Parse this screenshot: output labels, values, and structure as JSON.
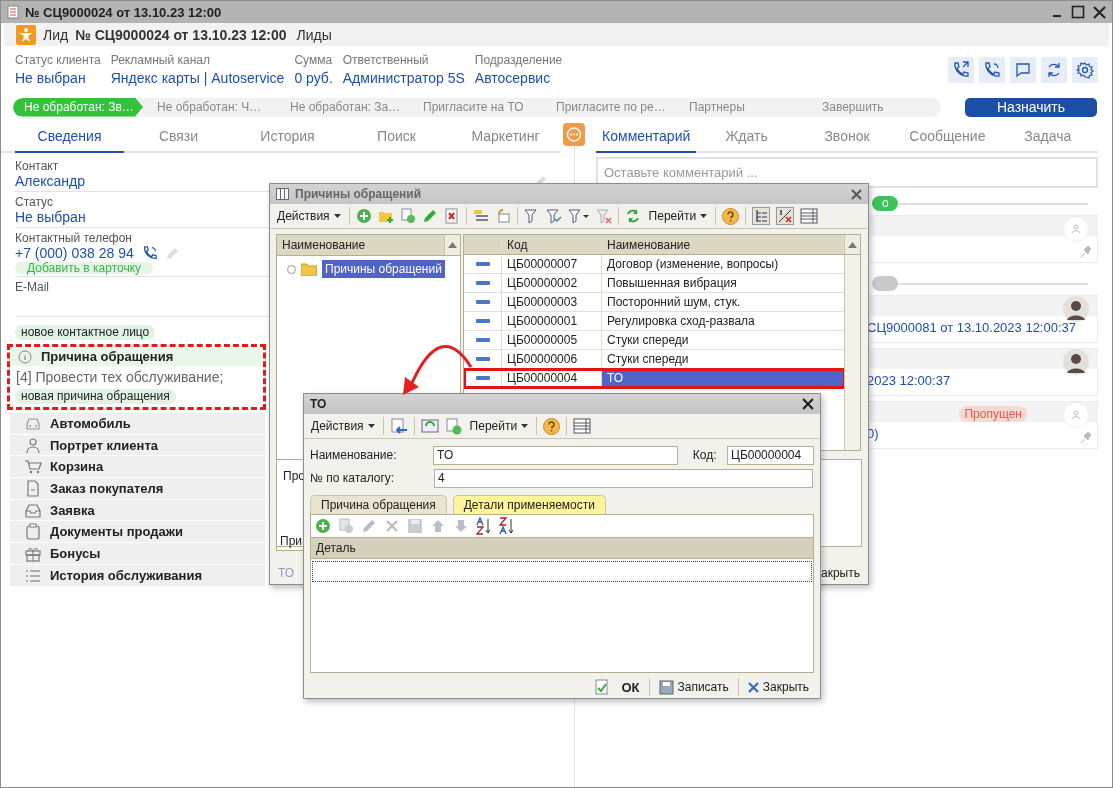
{
  "window": {
    "title": "№ СЦ9000024 от 13.10.23 12:00"
  },
  "header": {
    "type_label": "Лид",
    "number": "№ СЦ9000024 от 13.10.23 12:00",
    "section": "Лиды"
  },
  "fields": [
    {
      "label": "Статус клиента",
      "value": "Не выбран"
    },
    {
      "label": "Рекламный канал",
      "value": "Яндекс карты | Autoservice"
    },
    {
      "label": "Сумма",
      "value": "0 руб."
    },
    {
      "label": "Ответственный",
      "value": "Администратор 5S"
    },
    {
      "label": "Подразделение",
      "value": "Автосервис"
    }
  ],
  "stages": [
    {
      "label": "Не обработан: Зв…",
      "selected": true
    },
    {
      "label": "Не обработан: Ч…",
      "selected": false
    },
    {
      "label": "Не обработан: За…",
      "selected": false
    },
    {
      "label": "Пригласите на ТО",
      "selected": false
    },
    {
      "label": "Пригласите по ре…",
      "selected": false
    },
    {
      "label": "Партнеры",
      "selected": false
    },
    {
      "label": "Завершить",
      "selected": false
    }
  ],
  "assign_button": "Назначить",
  "left_tabs": [
    {
      "label": "Сведения",
      "selected": true
    },
    {
      "label": "Связи",
      "selected": false
    },
    {
      "label": "История",
      "selected": false
    },
    {
      "label": "Поиск",
      "selected": false
    },
    {
      "label": "Маркетинг",
      "selected": false
    }
  ],
  "details": [
    {
      "label": "Контакт",
      "value": "Александр"
    },
    {
      "label": "Статус",
      "value": "Не выбран"
    },
    {
      "label": "Контактный телефон",
      "value": "+7 (000) 038 28 94",
      "action": "Добавить в карточку"
    },
    {
      "label": "E-Mail"
    }
  ],
  "contact_tag": "новое контактное лицо",
  "reason": {
    "title": "Причина обращения",
    "value": "[4] Провести тех обслуживание;",
    "tag": "новая причина обращения"
  },
  "sections": [
    {
      "label": "Автомобиль"
    },
    {
      "label": "Портрет клиента"
    },
    {
      "label": "Корзина"
    },
    {
      "label": "Заказ покупателя"
    },
    {
      "label": "Заявка"
    },
    {
      "label": "Документы продажи"
    },
    {
      "label": "Бонусы"
    },
    {
      "label": "История обслуживания"
    }
  ],
  "right_tabs": [
    {
      "label": "Комментарий",
      "selected": true
    },
    {
      "label": "Ждать",
      "selected": false
    },
    {
      "label": "Звонок",
      "selected": false
    },
    {
      "label": "Сообщение",
      "selected": false
    },
    {
      "label": "Задача",
      "selected": false
    }
  ],
  "comment": {
    "placeholder": "Оставьте комментарий ..."
  },
  "feed": [
    {
      "kind": "divider",
      "color": "#3cc35a",
      "label": "о"
    },
    {
      "kind": "card",
      "photo": false,
      "pinned": true
    },
    {
      "kind": "divider",
      "color": "#c9c9c9"
    },
    {
      "kind": "card",
      "photo": true,
      "text": "СЦ9000081 от 13.10.2023 12:00:37",
      "pinned": false
    },
    {
      "kind": "card",
      "photo": true,
      "text": "2023 12:00:37",
      "pinned": false
    },
    {
      "kind": "card",
      "photo": false,
      "badge": "Пропущен",
      "text": "0)",
      "pinned": true
    }
  ],
  "reasons_dialog": {
    "title": "Причины обращений",
    "actions": "Действия",
    "goto": "Перейти",
    "tree": {
      "column": "Наименование",
      "items": [
        {
          "label": "Причины обращений",
          "selected": true
        }
      ]
    },
    "table": {
      "columns": [
        "Код",
        "Наименование"
      ],
      "rows": [
        {
          "code": "ЦБ00000007",
          "name": "Договор (изменение, вопросы)",
          "selected": false
        },
        {
          "code": "ЦБ00000002",
          "name": "Повышенная вибрация",
          "selected": false
        },
        {
          "code": "ЦБ00000003",
          "name": "Посторонний шум, стук.",
          "selected": false
        },
        {
          "code": "ЦБ00000001",
          "name": "Регулировка сход-развала",
          "selected": false
        },
        {
          "code": "ЦБ00000005",
          "name": "Стуки спереди",
          "selected": false
        },
        {
          "code": "ЦБ00000006",
          "name": "Стуки спереди",
          "selected": false
        },
        {
          "code": "ЦБ00000004",
          "name": "ТО",
          "selected": true
        }
      ]
    },
    "description_fragment": "Про",
    "tab_fragment": "При",
    "status": "ТО",
    "close_fragment": "акрыть"
  },
  "item_dialog": {
    "title": "ТО",
    "actions": "Действия",
    "goto": "Перейти",
    "name_label": "Наименование:",
    "name": "ТО",
    "code_label": "Код:",
    "code": "ЦБ00000004",
    "catalog_label": "№ по каталогу:",
    "catalog": "4",
    "tabs": [
      {
        "label": "Причина обращения",
        "selected": false
      },
      {
        "label": "Детали применяемости",
        "selected": true
      }
    ],
    "table": {
      "columns": [
        "Деталь"
      ]
    },
    "buttons": {
      "ok": "ОК",
      "save": "Записать",
      "close": "Закрыть"
    }
  }
}
